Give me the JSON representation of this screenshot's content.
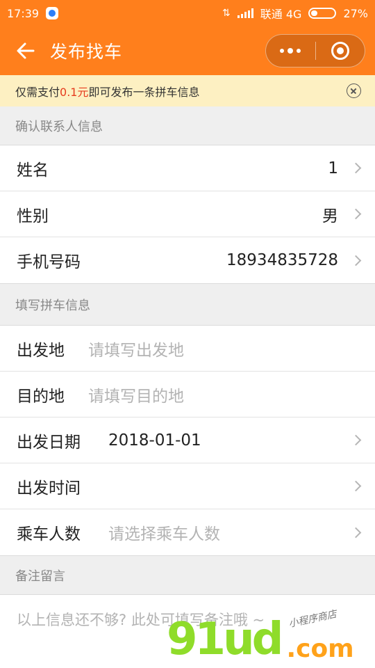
{
  "status_bar": {
    "time": "17:39",
    "carrier": "联通 4G",
    "battery": "27%",
    "battery_level": 0.27
  },
  "nav": {
    "title": "发布找车"
  },
  "notice": {
    "prefix": "仅需支付",
    "price": "0.1元",
    "suffix": "即可发布一条拼车信息"
  },
  "contact_section": {
    "heading": "确认联系人信息",
    "rows": [
      {
        "label": "姓名",
        "value": "1"
      },
      {
        "label": "性别",
        "value": "男"
      },
      {
        "label": "手机号码",
        "value": "18934835728"
      }
    ]
  },
  "trip_section": {
    "heading": "填写拼车信息",
    "origin": {
      "label": "出发地",
      "placeholder": "请填写出发地"
    },
    "destination": {
      "label": "目的地",
      "placeholder": "请填写目的地"
    },
    "date": {
      "label": "出发日期",
      "value": "2018-01-01"
    },
    "time": {
      "label": "出发时间",
      "value": ""
    },
    "passengers": {
      "label": "乘车人数",
      "placeholder": "请选择乘车人数"
    }
  },
  "memo_section": {
    "heading": "备注留言",
    "placeholder": "以上信息还不够? 此处可填写备注哦 ~"
  },
  "watermark": {
    "main": "91ud",
    "domain": ".com",
    "tagline": "小程序商店"
  },
  "colors": {
    "brand_orange": "#ff7f1c",
    "notice_bg": "#fdf0c2",
    "price_red": "#e63b1e"
  }
}
